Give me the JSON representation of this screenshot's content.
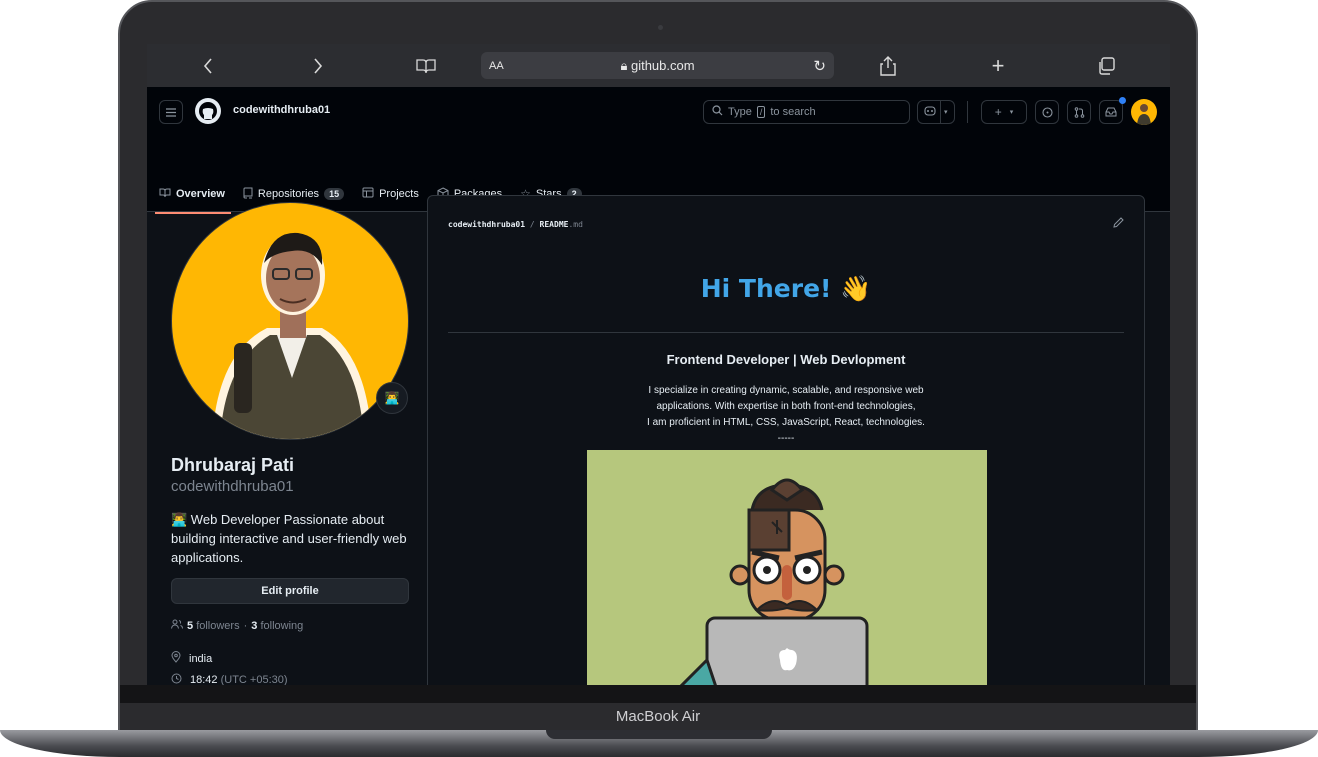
{
  "device": {
    "label": "MacBook Air"
  },
  "browser": {
    "back_icon": "chevron-left-icon",
    "forward_icon": "chevron-right-icon",
    "bookmarks_icon": "book-icon",
    "text_size": "AA",
    "url": "github.com",
    "reload_icon": "reload-icon",
    "share_icon": "share-icon",
    "new_tab_icon": "plus-icon",
    "tabs_icon": "tabs-icon"
  },
  "header": {
    "username": "codewithdhruba01",
    "search_prefix": "Type",
    "search_key": "/",
    "search_suffix": "to search",
    "plus_label": "+"
  },
  "nav": {
    "tabs": [
      {
        "label": "Overview",
        "icon": "book-icon",
        "active": true
      },
      {
        "label": "Repositories",
        "icon": "repo-icon",
        "count": "15"
      },
      {
        "label": "Projects",
        "icon": "table-icon"
      },
      {
        "label": "Packages",
        "icon": "package-icon"
      },
      {
        "label": "Stars",
        "icon": "star-icon",
        "count": "2"
      }
    ]
  },
  "profile": {
    "name": "Dhrubaraj Pati",
    "login": "codewithdhruba01",
    "status_emoji": "👨‍💻",
    "bio": "👨‍💻 Web Developer Passionate about building interactive and user-friendly web applications.",
    "edit_label": "Edit profile",
    "followers_count": "5",
    "followers_label": "followers",
    "separator": "·",
    "following_count": "3",
    "following_label": "following",
    "location": "india",
    "time": "18:42",
    "timezone": "(UTC +05:30)"
  },
  "readme": {
    "path_user": "codewithdhruba01",
    "path_sep": "/",
    "path_file": "README",
    "path_ext": ".md",
    "heading": "Hi There! 👋",
    "role": "Frontend Developer | Web Devlopment",
    "desc_line1": "I specialize in creating dynamic, scalable, and responsive web",
    "desc_line2": "applications. With expertise in both front-end technologies,",
    "desc_line3": "I am proficient in HTML, CSS, JavaScript, React, technologies.",
    "divider": "-----"
  },
  "colors": {
    "accent_tab": "#fd8c73",
    "heading_blue": "#42a6e8",
    "avatar_bg": "#ffb703",
    "art_bg": "#b6c77d"
  }
}
